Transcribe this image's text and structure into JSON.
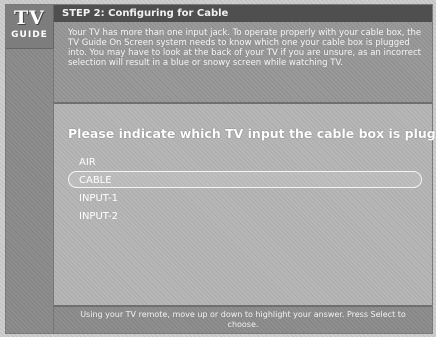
{
  "logo": {
    "line1": "TV",
    "line2": "GUIDE"
  },
  "header": {
    "title": "STEP 2: Configuring for Cable"
  },
  "intro": {
    "text": "Your TV has more than one input jack. To operate properly with your cable box, the TV Guide On Screen system needs to know which one your cable box is plugged into. You may have to look at the back of your TV if you are unsure, as an incorrect selection will result in a blue or snowy screen while watching TV."
  },
  "main": {
    "question": "Please indicate which TV input the cable box is plugged into.",
    "options": [
      {
        "label": "AIR",
        "selected": false
      },
      {
        "label": "CABLE",
        "selected": true
      },
      {
        "label": "INPUT-1",
        "selected": false
      },
      {
        "label": "INPUT-2",
        "selected": false
      }
    ]
  },
  "footer": {
    "text": "Using your TV remote, move up or down to highlight your answer. Press Select to choose."
  }
}
